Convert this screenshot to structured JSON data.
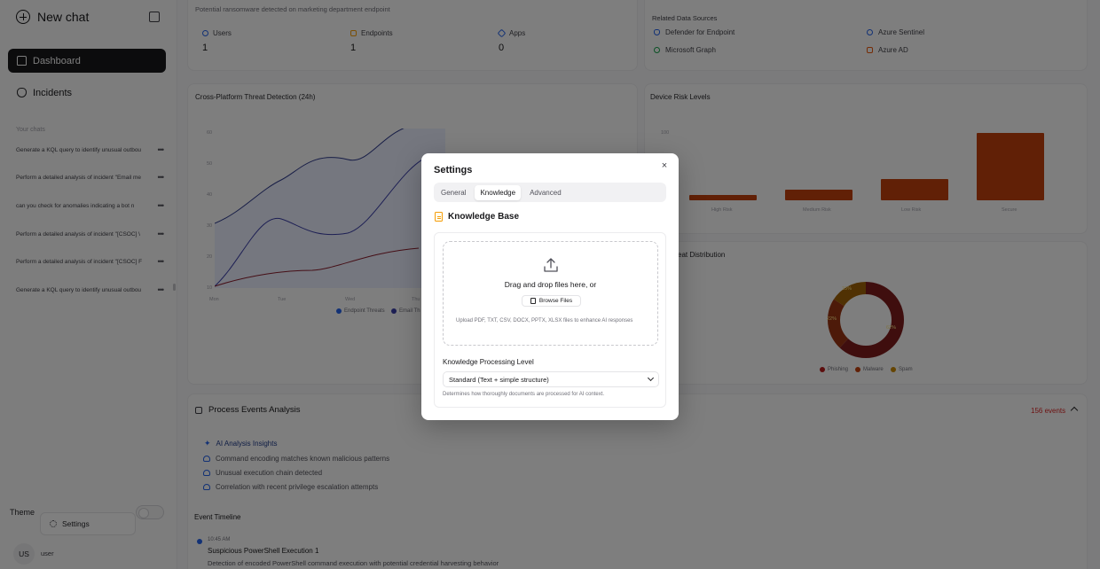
{
  "sidebar": {
    "new_chat": "New chat",
    "nav": [
      {
        "label": "Dashboard",
        "active": true
      },
      {
        "label": "Incidents",
        "active": false
      }
    ],
    "section_label": "Your chats",
    "chats": [
      "Generate a KQL query to identify unusual outbou",
      "Perform a detailed analysis of incident \"Email me",
      "can you check for anomalies indicating a bot n",
      "Perform a detailed analysis of incident \"[CSOC] \\",
      "Perform a detailed analysis of incident \"[CSOC] F",
      "Generate a KQL query to identify unusual outbou"
    ],
    "theme_label": "Theme",
    "settings_label": "Settings",
    "avatar_initials": "US",
    "username": "user"
  },
  "incident": {
    "summary": "Potential ransomware detected on marketing department endpoint",
    "stats": [
      {
        "label": "Users",
        "value": "1",
        "color": "#2563eb"
      },
      {
        "label": "Endpoints",
        "value": "1",
        "color": "#f59e0b"
      },
      {
        "label": "Apps",
        "value": "0",
        "color": "#2563eb"
      }
    ],
    "related_title": "Related Data Sources",
    "sources": [
      "Defender for Endpoint",
      "Azure Sentinel",
      "Microsoft Graph",
      "Azure AD"
    ]
  },
  "threat_chart": {
    "title": "Cross-Platform Threat Detection (24h)",
    "y_ticks": [
      "60",
      "50",
      "40",
      "30",
      "20",
      "10"
    ],
    "x_ticks": [
      "Mon",
      "Tue",
      "Wed",
      "Thu"
    ],
    "legend": [
      "Endpoint Threats",
      "Email Th"
    ]
  },
  "risk_chart": {
    "title": "Device Risk Levels",
    "y_tick": "100",
    "categories": [
      "High Risk",
      "Medium Risk",
      "Low Risk",
      "Secure"
    ],
    "values": [
      8,
      16,
      32,
      100
    ]
  },
  "distribution": {
    "title": "eat Distribution",
    "labels": [
      "62%",
      "22%",
      "15%"
    ],
    "legend": [
      "Phishing",
      "Malware",
      "Spam"
    ]
  },
  "process": {
    "title": "Process Events Analysis",
    "count": "156 events",
    "insights_title": "AI Analysis Insights",
    "insights": [
      "Command encoding matches known malicious patterns",
      "Unusual execution chain detected",
      "Correlation with recent privilege escalation attempts"
    ]
  },
  "timeline": {
    "title": "Event Timeline",
    "time": "10:45 AM",
    "event_title": "Suspicious PowerShell Execution 1",
    "event_desc": "Detection of encoded PowerShell command execution with potential credential harvesting behavior"
  },
  "settings_modal": {
    "title": "Settings",
    "close": "×",
    "tabs": [
      {
        "label": "General",
        "active": false
      },
      {
        "label": "Knowledge",
        "active": true
      },
      {
        "label": "Advanced",
        "active": false
      }
    ],
    "kb_title": "Knowledge Base",
    "drop_text": "Drag and drop files here, or",
    "browse_label": "Browse Files",
    "hint": "Upload PDF, TXT, CSV, DOCX, PPTX, XLSX files to enhance AI responses",
    "level_label": "Knowledge Processing Level",
    "level_value": "Standard (Text + simple structure)",
    "level_hint": "Determines how thoroughly documents are processed for AI context."
  }
}
